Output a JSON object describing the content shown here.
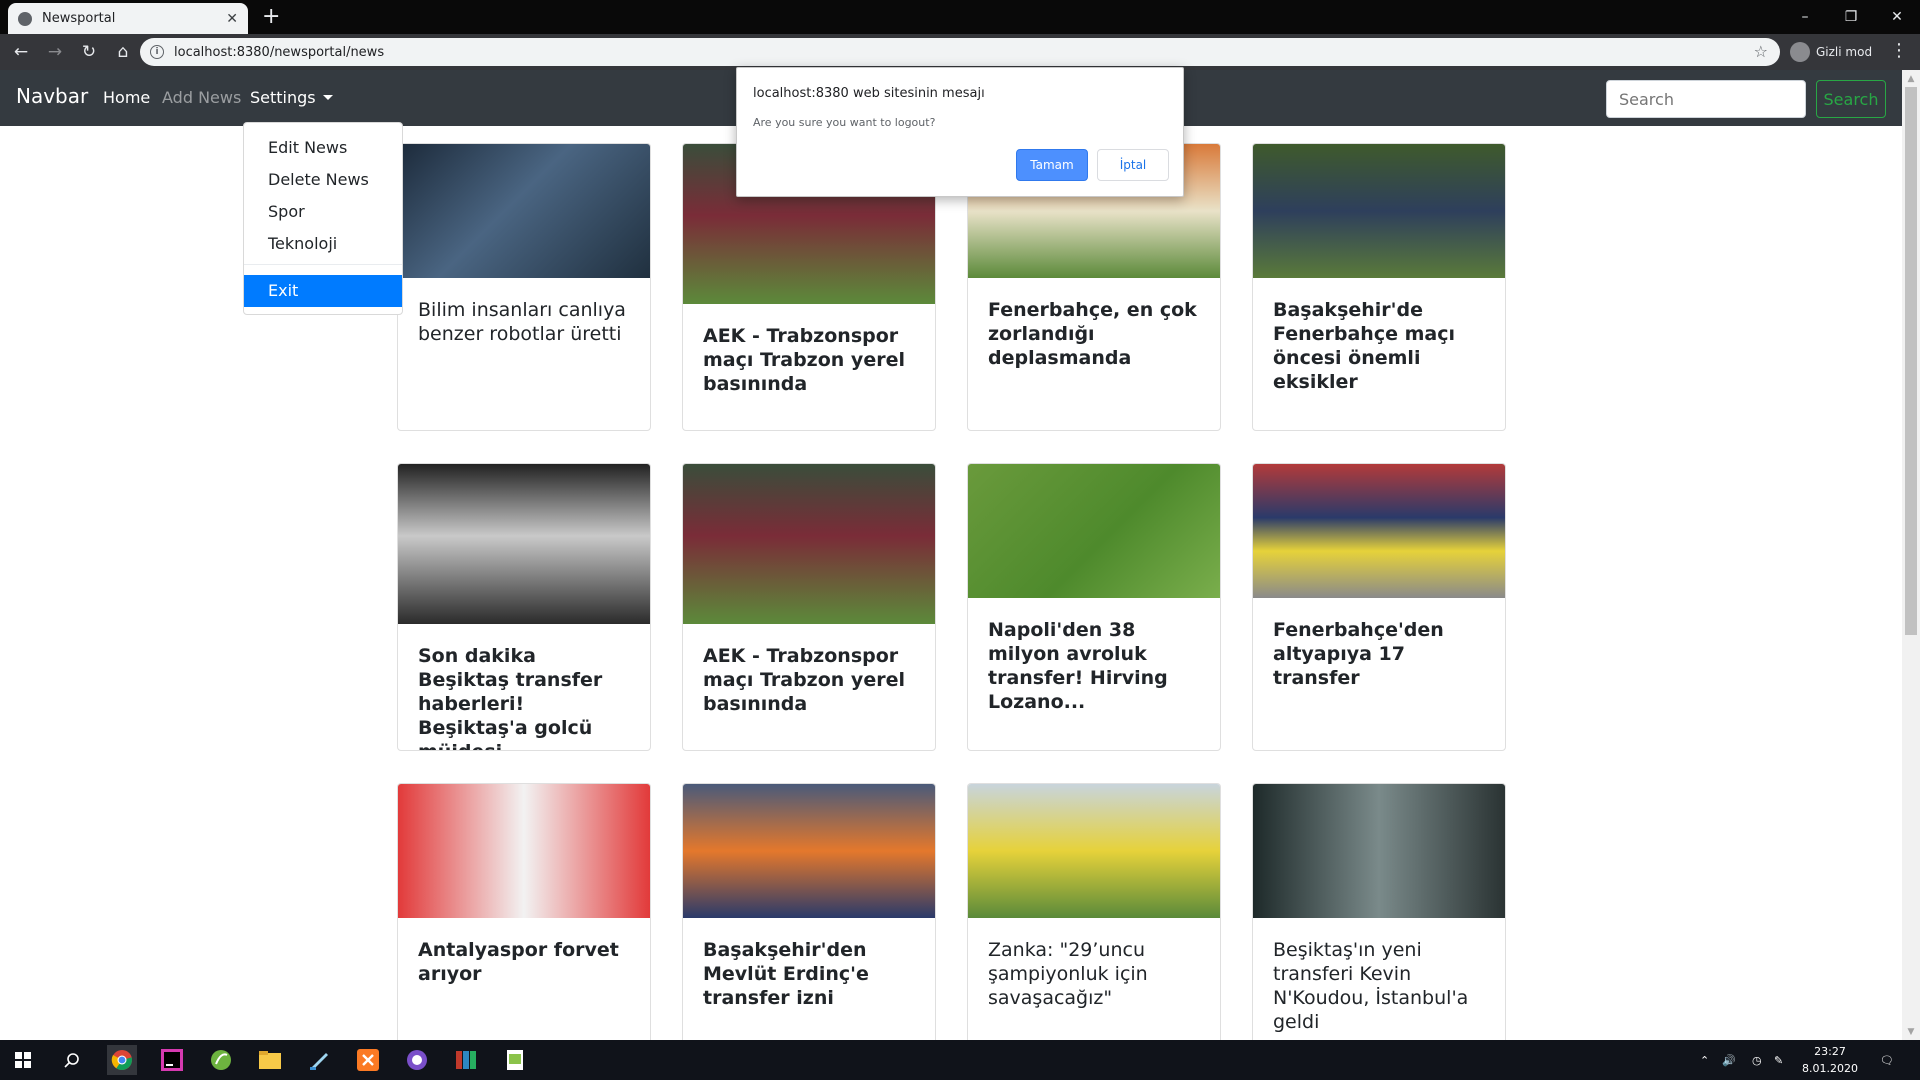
{
  "browser": {
    "tab_title": "Newsportal",
    "tab_close": "✕",
    "new_tab": "+",
    "url": "localhost:8380/newsportal/news",
    "profile_label": "Gizli mod"
  },
  "navbar": {
    "brand": "Navbar",
    "home": "Home",
    "add_news": "Add News",
    "settings": "Settings",
    "search_placeholder": "Search",
    "search_button": "Search"
  },
  "dropdown": {
    "items": [
      "Edit News",
      "Delete News",
      "Spor",
      "Teknoloji"
    ],
    "exit": "Exit"
  },
  "dialog": {
    "title": "localhost:8380 web sitesinin mesajı",
    "message": "Are you sure you want to logout?",
    "ok": "Tamam",
    "cancel": "İptal"
  },
  "cards": [
    {
      "title": "Bilim insanları canlıya benzer robotlar üretti"
    },
    {
      "title": "AEK - Trabzonspor maçı Trabzon yerel basınında"
    },
    {
      "title": "Fenerbahçe, en çok zorlandığı deplasmanda"
    },
    {
      "title": "Başakşehir'de Fenerbahçe maçı öncesi önemli eksikler"
    },
    {
      "title": "Son dakika Beşiktaş transfer haberleri! Beşiktaş'a golcü müjdesi"
    },
    {
      "title": "AEK - Trabzonspor maçı Trabzon yerel basınında"
    },
    {
      "title": "Napoli'den 38 milyon avroluk transfer! Hirving Lozano..."
    },
    {
      "title": "Fenerbahçe'den altyapıya 17 transfer"
    },
    {
      "title": "Antalyaspor forvet arıyor"
    },
    {
      "title": "Başakşehir'den Mevlüt Erdinç'e transfer izni"
    },
    {
      "title": "Zanka: \"29’uncu şampiyonluk için savaşacağız\""
    },
    {
      "title": "Beşiktaş'ın yeni transferi Kevin N'Koudou, İstanbul'a geldi"
    }
  ],
  "taskbar": {
    "time": "23:27",
    "date": "8.01.2020"
  }
}
